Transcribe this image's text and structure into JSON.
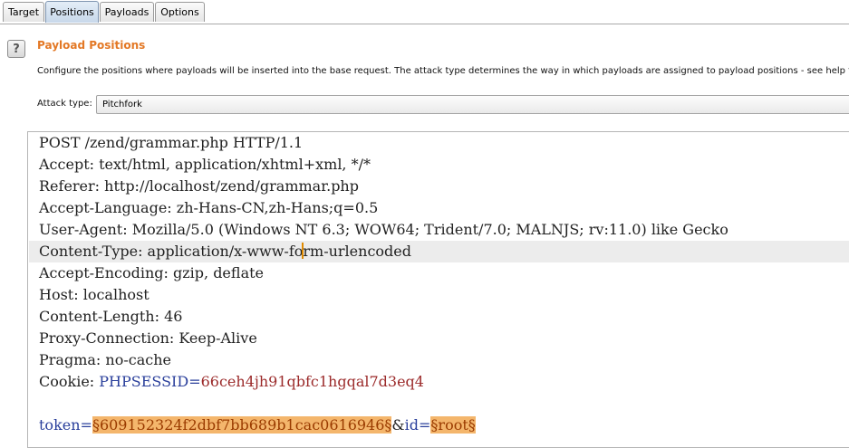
{
  "tabs": [
    {
      "label": "Target"
    },
    {
      "label": "Positions"
    },
    {
      "label": "Payloads"
    },
    {
      "label": "Options"
    }
  ],
  "help_icon": {
    "glyph": "?"
  },
  "section": {
    "title": "Payload Positions",
    "description": "Configure the positions where payloads will be inserted into the base request. The attack type determines the way in which payloads are assigned to payload positions - see help for full"
  },
  "attack_type": {
    "label": "Attack type:",
    "value": "Pitchfork"
  },
  "request": {
    "line1": "POST /zend/grammar.php HTTP/1.1",
    "line2": "Accept: text/html, application/xhtml+xml, */*",
    "line3": "Referer: http://localhost/zend/grammar.php",
    "line4": "Accept-Language: zh-Hans-CN,zh-Hans;q=0.5",
    "line5": "User-Agent: Mozilla/5.0 (Windows NT 6.3; WOW64; Trident/7.0; MALNJS; rv:11.0) like Gecko",
    "line6_before_caret": "Content-Type: application/x-www-fo",
    "line6_after_caret": "rm-urlencoded",
    "line7": "Accept-Encoding: gzip, deflate",
    "line8": "Host: localhost",
    "line9": "Content-Length: 46",
    "line10": "Proxy-Connection: Keep-Alive",
    "line11": "Pragma: no-cache",
    "cookie_label": "Cookie: ",
    "cookie_name": "PHPSESSID",
    "cookie_eq": "=",
    "cookie_value": "66ceh4jh91qbfc1hgqal7d3eq4",
    "body_param1": "token",
    "body_eq1": "=",
    "body_pos1": "§609152324f2dbf7bb689b1cac0616946§",
    "body_amp": "&",
    "body_param2": "id",
    "body_eq2": "=",
    "body_pos2": "§root§"
  },
  "colors": {
    "title": "#e37825",
    "payload_marker_bg": "#f4b66c",
    "param_name": "#2a3f9b",
    "param_value": "#9b2a2a"
  }
}
